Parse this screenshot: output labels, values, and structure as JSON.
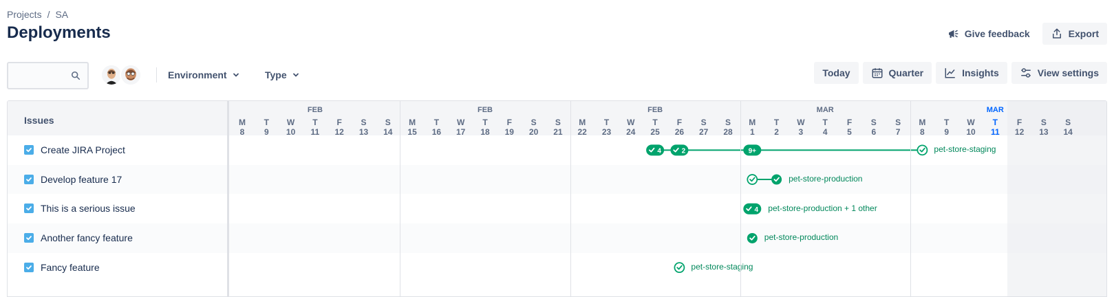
{
  "breadcrumb": {
    "root": "Projects",
    "separator": "/",
    "current": "SA"
  },
  "page": {
    "title": "Deployments"
  },
  "actions": {
    "feedback": "Give feedback",
    "export": "Export"
  },
  "toolbar": {
    "search_placeholder": "",
    "environment": "Environment",
    "type": "Type",
    "today": "Today",
    "quarter": "Quarter",
    "insights": "Insights",
    "view_settings": "View settings"
  },
  "grid": {
    "issues_header": "Issues"
  },
  "issues": [
    {
      "label": "Create JIRA Project"
    },
    {
      "label": "Develop feature 17"
    },
    {
      "label": "This is a serious issue"
    },
    {
      "label": "Another fancy feature"
    },
    {
      "label": "Fancy feature"
    }
  ],
  "weeks": [
    {
      "month": "FEB",
      "days": [
        "8",
        "9",
        "10",
        "11",
        "12",
        "13",
        "14"
      ]
    },
    {
      "month": "FEB",
      "days": [
        "15",
        "16",
        "17",
        "18",
        "19",
        "20",
        "21"
      ]
    },
    {
      "month": "FEB",
      "days": [
        "22",
        "23",
        "24",
        "25",
        "26",
        "27",
        "28"
      ]
    },
    {
      "month": "MAR",
      "days": [
        "1",
        "2",
        "3",
        "4",
        "5",
        "6",
        "7"
      ]
    },
    {
      "month": "MAR",
      "days": [
        "8",
        "9",
        "10",
        "11",
        "12",
        "13",
        "14"
      ]
    }
  ],
  "dow": [
    "M",
    "T",
    "W",
    "T",
    "F",
    "S",
    "S"
  ],
  "today": {
    "week": 4,
    "day": 3
  },
  "deployments": [
    {
      "row": 0,
      "markers": [
        {
          "day": 17,
          "kind": "pill",
          "text": "4"
        },
        {
          "day": 18,
          "kind": "pill",
          "text": "2"
        },
        {
          "day": 21,
          "kind": "pill-plain",
          "text": "9+"
        },
        {
          "day": 28,
          "kind": "open"
        }
      ],
      "label": "pet-store-staging"
    },
    {
      "row": 1,
      "markers": [
        {
          "day": 21,
          "kind": "open"
        },
        {
          "day": 22,
          "kind": "filled"
        }
      ],
      "label": "pet-store-production"
    },
    {
      "row": 2,
      "markers": [
        {
          "day": 21,
          "kind": "pill",
          "text": "4"
        }
      ],
      "label": "pet-store-production + 1 other"
    },
    {
      "row": 3,
      "markers": [
        {
          "day": 21,
          "kind": "filled"
        }
      ],
      "label": "pet-store-production"
    },
    {
      "row": 4,
      "markers": [
        {
          "day": 18,
          "kind": "open"
        }
      ],
      "label": "pet-store-staging"
    }
  ],
  "colors": {
    "green": "#00a36c",
    "text_green": "#00875a",
    "today_blue": "#0065ff",
    "check_blue": "#4bade8"
  }
}
